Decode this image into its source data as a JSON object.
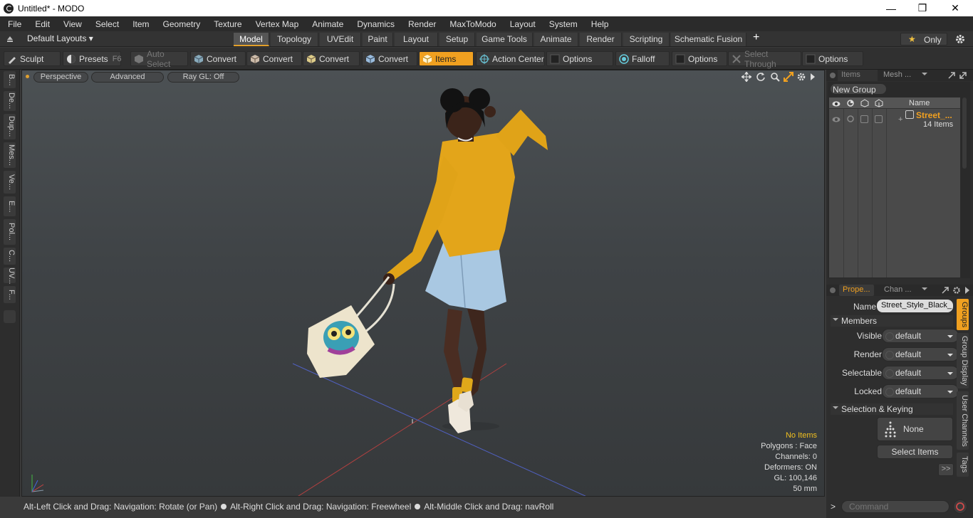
{
  "window": {
    "title": "Untitled* - MODO",
    "minimize": "—",
    "restore": "❒",
    "close": "✕"
  },
  "menu": [
    "File",
    "Edit",
    "View",
    "Select",
    "Item",
    "Geometry",
    "Texture",
    "Vertex Map",
    "Animate",
    "Dynamics",
    "Render",
    "MaxToModo",
    "Layout",
    "System",
    "Help"
  ],
  "layouts": {
    "label": "Default Layouts ▾",
    "tabs": [
      "Model",
      "Topology",
      "UVEdit",
      "Paint",
      "Layout",
      "Setup",
      "Game Tools",
      "Animate",
      "Render",
      "Scripting",
      "Schematic Fusion"
    ],
    "active": "Model",
    "add": "+",
    "only": "Only",
    "star": "★"
  },
  "toolbar": {
    "sculpt": "Sculpt",
    "presets": "Presets",
    "presets_key": "F6",
    "auto_select": "Auto Select",
    "convert1": "Convert",
    "convert2": "Convert",
    "convert3": "Convert",
    "convert4": "Convert",
    "items": "Items",
    "action_center": "Action Center",
    "options1": "Options",
    "falloff": "Falloff",
    "options2": "Options",
    "select_through": "Select Through",
    "options3": "Options"
  },
  "left_strip": [
    "B...",
    "De...",
    "Dup...",
    "Mes...",
    "Ve...",
    "E...",
    "Pol...",
    "C...",
    "UV...",
    "F..."
  ],
  "viewport": {
    "perspective": "Perspective",
    "advanced": "Advanced",
    "raygl": "Ray GL: Off",
    "info": {
      "no_items": "No Items",
      "polygons": "Polygons : Face",
      "channels": "Channels: 0",
      "deformers": "Deformers: ON",
      "gl": "GL: 100,146",
      "mm": "50 mm"
    }
  },
  "status": {
    "hint1": "Alt-Left Click and Drag: Navigation: Rotate (or Pan)",
    "hint2": "Alt-Right Click and Drag: Navigation: Freewheel",
    "hint3": "Alt-Middle Click and Drag: navRoll"
  },
  "items_panel": {
    "tab_items": "Items",
    "tab_mesh": "Mesh ...",
    "new_group": "New Group",
    "col_name": "Name",
    "group_name": "Street_...",
    "group_count": "14 Items"
  },
  "properties": {
    "tab_props": "Prope...",
    "tab_chan": "Chan ...",
    "name_label": "Name",
    "name_value": "Street_Style_Black_",
    "members": "Members",
    "rows": [
      {
        "label": "Visible",
        "value": "default"
      },
      {
        "label": "Render",
        "value": "default"
      },
      {
        "label": "Selectable",
        "value": "default"
      },
      {
        "label": "Locked",
        "value": "default"
      }
    ],
    "sel_keying": "Selection & Keying",
    "none": "None",
    "select_items": "Select Items",
    "more": ">>",
    "side_tabs": [
      "Groups",
      "Group Display",
      "User Channels",
      "Tags"
    ]
  },
  "command": {
    "prompt": ">",
    "placeholder": "Command"
  },
  "colors": {
    "accent": "#f0a020",
    "sweater": "#e3a51a",
    "skirt": "#a9c8e2"
  }
}
